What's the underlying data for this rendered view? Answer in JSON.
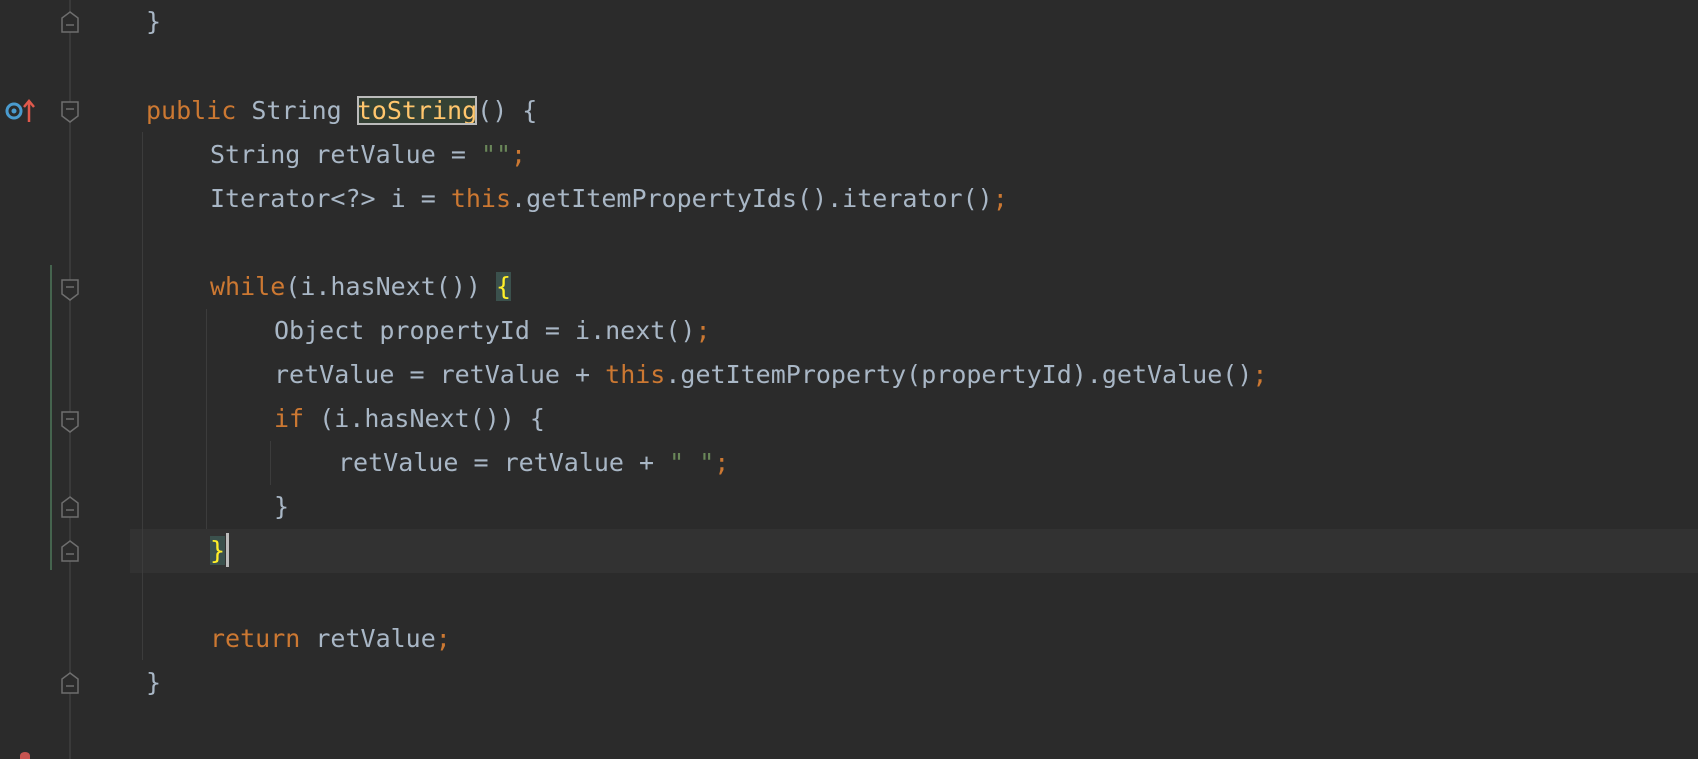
{
  "editor": {
    "lines": [
      {
        "id": "l1",
        "tokens": [
          {
            "t": "}",
            "c": "plain"
          }
        ]
      },
      {
        "id": "l3",
        "tokens": [
          {
            "t": "public",
            "c": "kw"
          },
          {
            "t": " String ",
            "c": "plain"
          },
          {
            "t": "toString",
            "c": "method-hl"
          },
          {
            "t": "() {",
            "c": "plain"
          }
        ]
      },
      {
        "id": "l4",
        "tokens": [
          {
            "t": "String retValue = ",
            "c": "plain"
          },
          {
            "t": "\"\"",
            "c": "str"
          },
          {
            "t": ";",
            "c": "kw"
          }
        ]
      },
      {
        "id": "l5",
        "tokens": [
          {
            "t": "Iterator<?> i = ",
            "c": "plain"
          },
          {
            "t": "this",
            "c": "kw"
          },
          {
            "t": ".getItemPropertyIds().iterator()",
            "c": "plain"
          },
          {
            "t": ";",
            "c": "kw"
          }
        ]
      },
      {
        "id": "l7",
        "tokens": [
          {
            "t": "while",
            "c": "kw"
          },
          {
            "t": "(i.hasNext()) ",
            "c": "plain"
          },
          {
            "t": "{",
            "c": "brace-hl"
          }
        ]
      },
      {
        "id": "l8",
        "tokens": [
          {
            "t": "Object propertyId = i.next()",
            "c": "plain"
          },
          {
            "t": ";",
            "c": "kw"
          }
        ]
      },
      {
        "id": "l9",
        "tokens": [
          {
            "t": "retValue = retValue + ",
            "c": "plain"
          },
          {
            "t": "this",
            "c": "kw"
          },
          {
            "t": ".getItemProperty(propertyId).getValue()",
            "c": "plain"
          },
          {
            "t": ";",
            "c": "kw"
          }
        ]
      },
      {
        "id": "l10",
        "tokens": [
          {
            "t": "if",
            "c": "kw"
          },
          {
            "t": " (i.hasNext()) {",
            "c": "plain"
          }
        ]
      },
      {
        "id": "l11",
        "tokens": [
          {
            "t": "retValue = retValue + ",
            "c": "plain"
          },
          {
            "t": "\" \"",
            "c": "str"
          },
          {
            "t": ";",
            "c": "kw"
          }
        ]
      },
      {
        "id": "l12",
        "tokens": [
          {
            "t": "}",
            "c": "plain"
          }
        ]
      },
      {
        "id": "l13",
        "tokens": [
          {
            "t": "}",
            "c": "brace-hl"
          }
        ]
      },
      {
        "id": "l15",
        "tokens": [
          {
            "t": "return",
            "c": "kw"
          },
          {
            "t": " retValue",
            "c": "plain"
          },
          {
            "t": ";",
            "c": "kw"
          }
        ]
      },
      {
        "id": "l16",
        "tokens": [
          {
            "t": "}",
            "c": "plain"
          }
        ]
      }
    ],
    "caret_line": "l13",
    "gutter_icons": [
      "implementing-method-icon",
      "override-up-arrow-icon"
    ]
  },
  "colors": {
    "background": "#2b2b2b",
    "text": "#a9b7c6",
    "keyword": "#cc7832",
    "string": "#6a8759",
    "method_highlight": "#ffc66d",
    "brace_highlight": "#ffef28"
  }
}
